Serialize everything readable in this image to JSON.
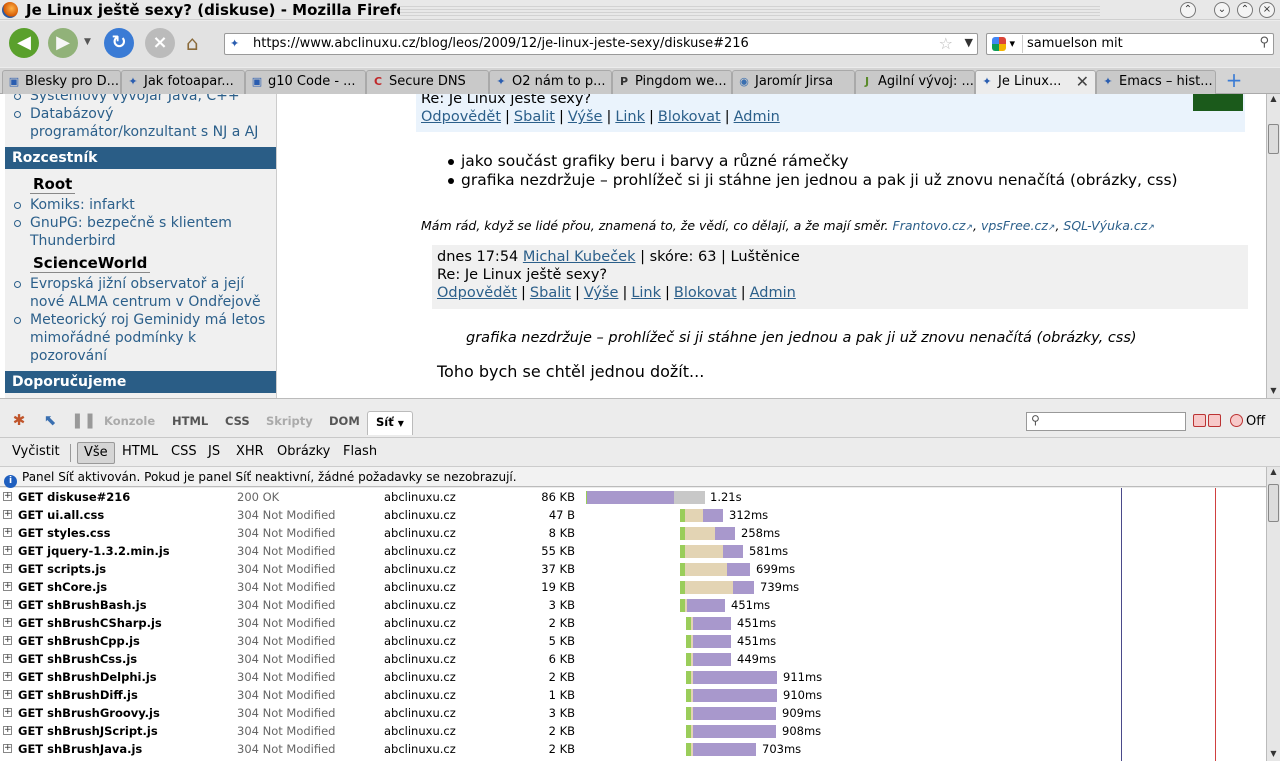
{
  "window": {
    "title": "Je Linux ještě sexy? (diskuse) - Mozilla Firefox"
  },
  "navbar": {
    "url": "https://www.abclinuxu.cz/blog/leos/2009/12/je-linux-jeste-sexy/diskuse#216",
    "search_query": "samuelson mit"
  },
  "tabs": [
    {
      "label": "Blesky pro D...",
      "icon": "page-icon"
    },
    {
      "label": "Jak fotoapar...",
      "icon": "abc-icon"
    },
    {
      "label": "g10 Code - ...",
      "icon": "page-icon"
    },
    {
      "label": "Secure DNS",
      "icon": "c-icon"
    },
    {
      "label": "O2 nám to p...",
      "icon": "abc-icon"
    },
    {
      "label": "Pingdom we...",
      "icon": "p-icon"
    },
    {
      "label": "Jaromír Jirsa",
      "icon": "globe-icon"
    },
    {
      "label": "Agilní vývoj: ...",
      "icon": "j-icon"
    },
    {
      "label": "Je Linux...",
      "icon": "abc-icon",
      "active": true
    },
    {
      "label": "Emacs – hist...",
      "icon": "abc-icon"
    }
  ],
  "sidebar": {
    "top_items": [
      "Systémový vývojář Java, C++",
      "Databázový programátor/konzultant s NJ a AJ"
    ],
    "section1": "Rozcestník",
    "group1": {
      "title": "Root",
      "items": [
        "Komiks: infarkt",
        "GnuPG: bezpečně s klientem Thunderbird"
      ]
    },
    "group2": {
      "title": "ScienceWorld",
      "items": [
        "Evropská jižní observatoř a její nové ALMA centrum v Ondřejově",
        "Meteorický roj Geminidy má letos mimořádné podmínky k pozorování"
      ]
    },
    "section2": "Doporučujeme"
  },
  "post": {
    "re_title": "Re: Je Linux ještě sexy?",
    "actions": [
      "Odpovědět",
      "Sbalit",
      "Výše",
      "Link",
      "Blokovat",
      "Admin"
    ],
    "bullets": [
      "jako součást grafiky beru i barvy a různé rámečky",
      "grafika nezdržuje – prohlížeč si ji stáhne jen jednou a pak ji už znovu nenačítá (obrázky, css)"
    ],
    "signature_text": "Mám rád, když se lidé přou, znamená to, že vědí, co dělají, a že mají směr.",
    "signature_links": [
      "Frantovo.cz",
      "vpsFree.cz",
      "SQL-Výuka.cz"
    ]
  },
  "comment": {
    "date": "dnes 17:54",
    "author": "Michal Kubeček",
    "meta": "| skóre: 63 | Luštěnice",
    "re_title": "Re: Je Linux ještě sexy?",
    "actions": [
      "Odpovědět",
      "Sbalit",
      "Výše",
      "Link",
      "Blokovat",
      "Admin"
    ],
    "quote": "grafika nezdržuje – prohlížeč si ji stáhne jen jednou a pak ji už znovu nenačítá (obrázky, css)",
    "text": "Toho bych se chtěl jednou dožít..."
  },
  "firebug": {
    "tabs": [
      "Konzole",
      "HTML",
      "CSS",
      "Skripty",
      "DOM",
      "Síť"
    ],
    "active_tab": "Síť",
    "off_label": "Off",
    "filters": [
      "Vyčistit",
      "Vše",
      "HTML",
      "CSS",
      "JS",
      "XHR",
      "Obrázky",
      "Flash"
    ],
    "active_filter": "Vše",
    "info": "Panel Síť aktivován. Pokud je panel Síť neaktivní, žádné požadavky se nezobrazují.",
    "requests": [
      {
        "req": "GET diskuse#216",
        "status": "200 OK",
        "domain": "abclinuxu.cz",
        "size": "86 KB",
        "time": "1.21s"
      },
      {
        "req": "GET ui.all.css",
        "status": "304 Not Modified",
        "domain": "abclinuxu.cz",
        "size": "47 B",
        "time": "312ms"
      },
      {
        "req": "GET styles.css",
        "status": "304 Not Modified",
        "domain": "abclinuxu.cz",
        "size": "8 KB",
        "time": "258ms"
      },
      {
        "req": "GET jquery-1.3.2.min.js",
        "status": "304 Not Modified",
        "domain": "abclinuxu.cz",
        "size": "55 KB",
        "time": "581ms"
      },
      {
        "req": "GET scripts.js",
        "status": "304 Not Modified",
        "domain": "abclinuxu.cz",
        "size": "37 KB",
        "time": "699ms"
      },
      {
        "req": "GET shCore.js",
        "status": "304 Not Modified",
        "domain": "abclinuxu.cz",
        "size": "19 KB",
        "time": "739ms"
      },
      {
        "req": "GET shBrushBash.js",
        "status": "304 Not Modified",
        "domain": "abclinuxu.cz",
        "size": "3 KB",
        "time": "451ms"
      },
      {
        "req": "GET shBrushCSharp.js",
        "status": "304 Not Modified",
        "domain": "abclinuxu.cz",
        "size": "2 KB",
        "time": "451ms"
      },
      {
        "req": "GET shBrushCpp.js",
        "status": "304 Not Modified",
        "domain": "abclinuxu.cz",
        "size": "5 KB",
        "time": "451ms"
      },
      {
        "req": "GET shBrushCss.js",
        "status": "304 Not Modified",
        "domain": "abclinuxu.cz",
        "size": "6 KB",
        "time": "449ms"
      },
      {
        "req": "GET shBrushDelphi.js",
        "status": "304 Not Modified",
        "domain": "abclinuxu.cz",
        "size": "2 KB",
        "time": "911ms"
      },
      {
        "req": "GET shBrushDiff.js",
        "status": "304 Not Modified",
        "domain": "abclinuxu.cz",
        "size": "1 KB",
        "time": "910ms"
      },
      {
        "req": "GET shBrushGroovy.js",
        "status": "304 Not Modified",
        "domain": "abclinuxu.cz",
        "size": "3 KB",
        "time": "909ms"
      },
      {
        "req": "GET shBrushJScript.js",
        "status": "304 Not Modified",
        "domain": "abclinuxu.cz",
        "size": "2 KB",
        "time": "908ms"
      },
      {
        "req": "GET shBrushJava.js",
        "status": "304 Not Modified",
        "domain": "abclinuxu.cz",
        "size": "2 KB",
        "time": "703ms"
      }
    ]
  },
  "colors": {
    "sidebar_header": "#2a5d86",
    "link": "#2b5f8a",
    "bar_wait": "#e3d4b4",
    "bar_receive": "#a898cc",
    "bar_connect": "#9acd5a"
  }
}
